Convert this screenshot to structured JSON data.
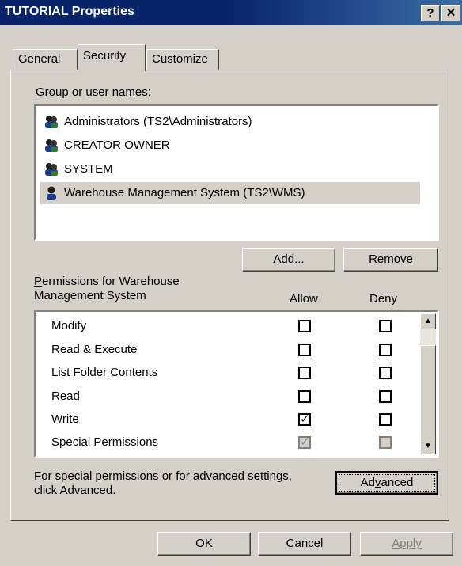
{
  "window": {
    "title": "TUTORIAL Properties",
    "help_label": "?",
    "close_label": "✕"
  },
  "tabs": [
    {
      "label": "General",
      "active": false
    },
    {
      "label": "Security",
      "active": true
    },
    {
      "label": "Customize",
      "active": false
    }
  ],
  "groups": {
    "label_prefix": "G",
    "label_rest": "roup or user names:",
    "items": [
      {
        "name": "Administrators (TS2\\Administrators)",
        "icon": "group-icon",
        "selected": false
      },
      {
        "name": "CREATOR OWNER",
        "icon": "group-icon",
        "selected": false
      },
      {
        "name": "SYSTEM",
        "icon": "group-icon",
        "selected": false
      },
      {
        "name": "Warehouse Management System (TS2\\WMS)",
        "icon": "user-icon",
        "selected": true
      }
    ]
  },
  "buttons": {
    "add_a": "A",
    "add_d": "d",
    "add_rest": "d...",
    "remove_r": "R",
    "remove_rest": "emove"
  },
  "permissions": {
    "label_p": "P",
    "label_line1_rest": "ermissions for Warehouse",
    "label_line2": "Management System",
    "allow_header": "Allow",
    "deny_header": "Deny",
    "rows": [
      {
        "name": "Modify",
        "allow": false,
        "deny": false
      },
      {
        "name": "Read & Execute",
        "allow": false,
        "deny": false
      },
      {
        "name": "List Folder Contents",
        "allow": false,
        "deny": false
      },
      {
        "name": "Read",
        "allow": false,
        "deny": false
      },
      {
        "name": "Write",
        "allow": true,
        "deny": false
      },
      {
        "name": "Special Permissions",
        "allow": true,
        "deny": false,
        "disabled": true
      }
    ]
  },
  "advanced": {
    "text_line1": "For special permissions or for advanced settings,",
    "text_line2": "click Advanced.",
    "button_pre": "Ad",
    "button_u": "v",
    "button_post": "anced"
  },
  "footer": {
    "ok": "OK",
    "cancel": "Cancel",
    "apply": "Apply"
  }
}
